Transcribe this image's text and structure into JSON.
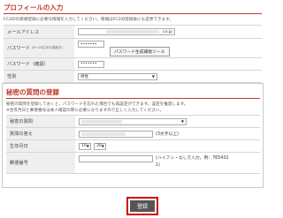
{
  "profile": {
    "title": "プロフィールの入力",
    "desc": "FC2IDの新規登録に必要な情報を入力してください。情報はFC2ID登録後にも変更できます。",
    "fields": {
      "email_label": "メールアドレス",
      "email_value": ".co.jp",
      "password_label": "パスワード",
      "password_note": "(8〜16文字の英数字)",
      "password_value": "•••••••",
      "tool_button": "パスワード生成補助ツール",
      "confirm_label": "パスワード（確認）",
      "confirm_value": "•••••••",
      "gender_label": "性別",
      "gender_value": "男性"
    }
  },
  "secret": {
    "title": "秘密の質問の登録",
    "desc1": "秘密の質問を登録しておくと、パスワードを忘れた場合でも再設定ができます。設定を推奨します。",
    "desc2": "※生年月日と郵便番号は本人確認の際に必要になりますので正しく入力してください。",
    "fields": {
      "question_label": "秘密の質問",
      "answer_label": "質問の答え",
      "answer_hint": "(3文字以上)",
      "birth_label": "生年月日",
      "birth_month": "10",
      "birth_day": "30",
      "postal_label": "郵便番号",
      "postal_hint": "(ハイフン・なしで入力。例：765432",
      "postal_hint2": "1)"
    }
  },
  "submit": {
    "label": "登録"
  }
}
